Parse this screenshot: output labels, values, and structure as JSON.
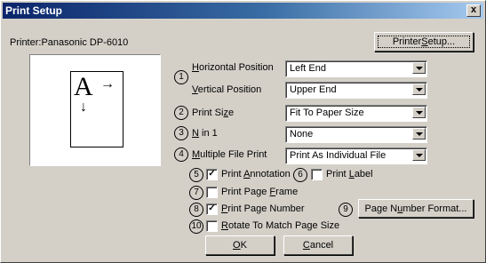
{
  "window": {
    "title": "Print Setup",
    "close_label": "x"
  },
  "printer_label": "Printer:Panasonic DP-6010",
  "printer_setup_button": {
    "before": "Printer ",
    "accel": "S",
    "after": "etup..."
  },
  "preview": {
    "letter": "A",
    "right_arrow": "→",
    "down_arrow": "↓"
  },
  "numbers": [
    "1",
    "2",
    "3",
    "4",
    "5",
    "6",
    "7",
    "8",
    "9",
    "10"
  ],
  "fields": {
    "horizontal": {
      "accel": "H",
      "rest": "orizontal Position",
      "value": "Left End"
    },
    "vertical": {
      "accel": "V",
      "rest": "ertical Position",
      "value": "Upper End"
    },
    "print_size": {
      "before": "Print Si",
      "accel": "z",
      "after": "e",
      "value": "Fit To Paper Size"
    },
    "n_in_1": {
      "accel": "N",
      "rest": " in 1",
      "value": "None"
    },
    "multiple": {
      "accel": "M",
      "rest": "ultiple File Print",
      "value": "Print As Individual File"
    }
  },
  "checkboxes": {
    "annotation": {
      "before": "Print ",
      "accel": "A",
      "after": "nnotation",
      "checked": true
    },
    "label": {
      "before": "Print ",
      "accel": "L",
      "after": "abel",
      "checked": false
    },
    "frame": {
      "before": "Print Page ",
      "accel": "F",
      "after": "rame",
      "checked": false
    },
    "page_number": {
      "before": "",
      "accel": "P",
      "after": "rint Page Number",
      "checked": true
    },
    "rotate": {
      "before": "",
      "accel": "R",
      "after": "otate To Match Page Size",
      "checked": false
    }
  },
  "page_number_format_button": {
    "before": "Page N",
    "accel": "u",
    "after": "mber Format..."
  },
  "ok_button": {
    "accel": "O",
    "after": "K"
  },
  "cancel_button": {
    "accel": "C",
    "after": "ancel"
  },
  "check_mark": "✓"
}
